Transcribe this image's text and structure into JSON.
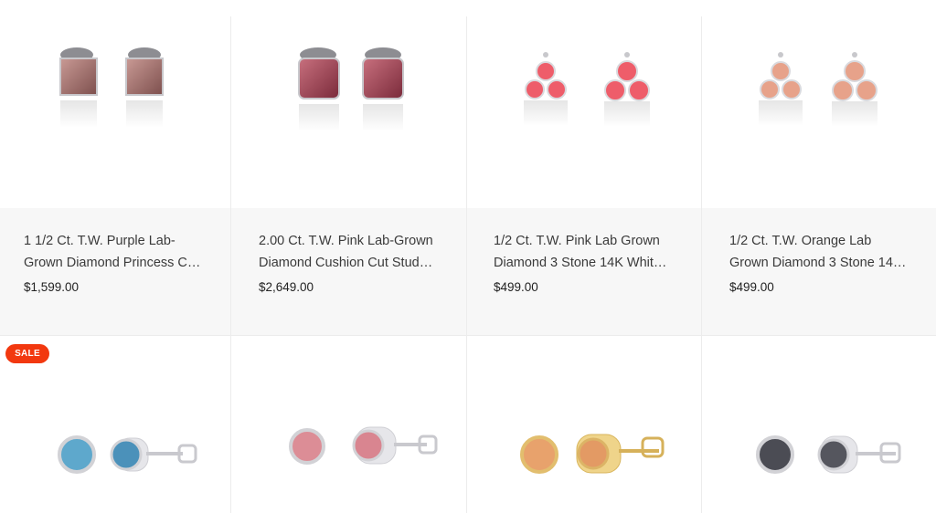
{
  "products": [
    {
      "title": "1 1/2 Ct. T.W. Purple Lab-Grown Diamond Princess C…",
      "price": "$1,599.00",
      "stone_color": "#a4716d",
      "metal": "white",
      "shape": "princess"
    },
    {
      "title": "2.00 Ct. T.W. Pink Lab-Grown Diamond Cushion Cut Stud…",
      "price": "$2,649.00",
      "stone_color": "#9c4050",
      "metal": "white",
      "shape": "cushion"
    },
    {
      "title": "1/2 Ct. T.W. Pink Lab Grown Diamond 3 Stone 14K Whit…",
      "price": "$499.00",
      "stone_color": "#ee5d6a",
      "metal": "white",
      "shape": "three-stone"
    },
    {
      "title": "1/2 Ct. T.W. Orange Lab Grown Diamond 3 Stone 14…",
      "price": "$499.00",
      "stone_color": "#e7a28a",
      "metal": "white",
      "shape": "three-stone"
    },
    {
      "badge": "SALE",
      "stone_color": "#5ea8cc",
      "metal": "white",
      "shape": "bezel"
    },
    {
      "stone_color": "#dc8d96",
      "metal": "white",
      "shape": "bezel"
    },
    {
      "stone_color": "#e8a26c",
      "metal": "yellow",
      "shape": "bezel"
    },
    {
      "stone_color": "#4b4c54",
      "metal": "white",
      "shape": "bezel"
    }
  ]
}
